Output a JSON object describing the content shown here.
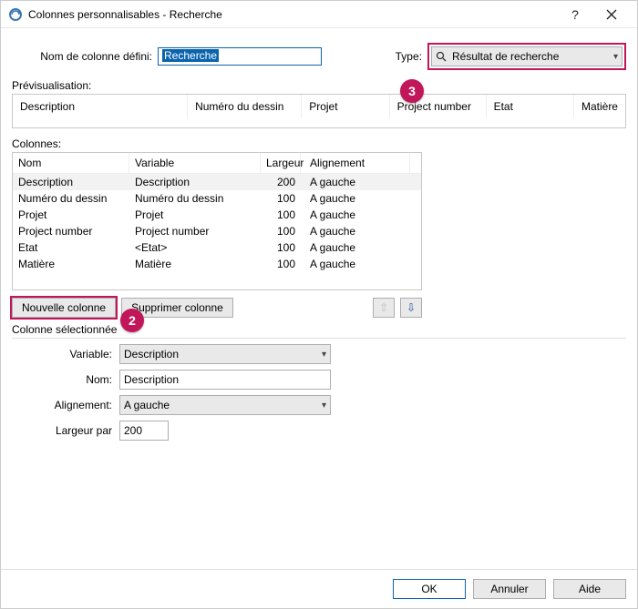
{
  "title": "Colonnes personnalisables - Recherche",
  "top": {
    "name_label": "Nom de colonne défini:",
    "name_value": "Recherche",
    "type_label": "Type:",
    "type_value": "Résultat de recherche"
  },
  "preview": {
    "label": "Prévisualisation:",
    "headers": [
      "Description",
      "Numéro du dessin",
      "Projet",
      "Project number",
      "Etat",
      "Matière"
    ]
  },
  "columns": {
    "label": "Colonnes:",
    "headers": {
      "nom": "Nom",
      "variable": "Variable",
      "largeur": "Largeur",
      "alignement": "Alignement"
    },
    "rows": [
      {
        "nom": "Description",
        "variable": "Description",
        "largeur": "200",
        "align": "A gauche",
        "selected": true
      },
      {
        "nom": "Numéro du dessin",
        "variable": "Numéro du dessin",
        "largeur": "100",
        "align": "A gauche"
      },
      {
        "nom": "Projet",
        "variable": "Projet",
        "largeur": "100",
        "align": "A gauche"
      },
      {
        "nom": "Project number",
        "variable": "Project number",
        "largeur": "100",
        "align": "A gauche"
      },
      {
        "nom": "Etat",
        "variable": "<Etat>",
        "largeur": "100",
        "align": "A gauche"
      },
      {
        "nom": "Matière",
        "variable": "Matière",
        "largeur": "100",
        "align": "A gauche"
      }
    ]
  },
  "buttons": {
    "new_col": "Nouvelle colonne",
    "del_col": "Supprimer colonne"
  },
  "selected_group": {
    "label": "Colonne sélectionnée",
    "variable_label": "Variable:",
    "variable_value": "Description",
    "name_label": "Nom:",
    "name_value": "Description",
    "align_label": "Alignement:",
    "align_value": "A gauche",
    "width_label": "Largeur par",
    "width_value": "200"
  },
  "footer": {
    "ok": "OK",
    "cancel": "Annuler",
    "help": "Aide"
  },
  "callouts": {
    "b2": "2",
    "b3": "3"
  }
}
